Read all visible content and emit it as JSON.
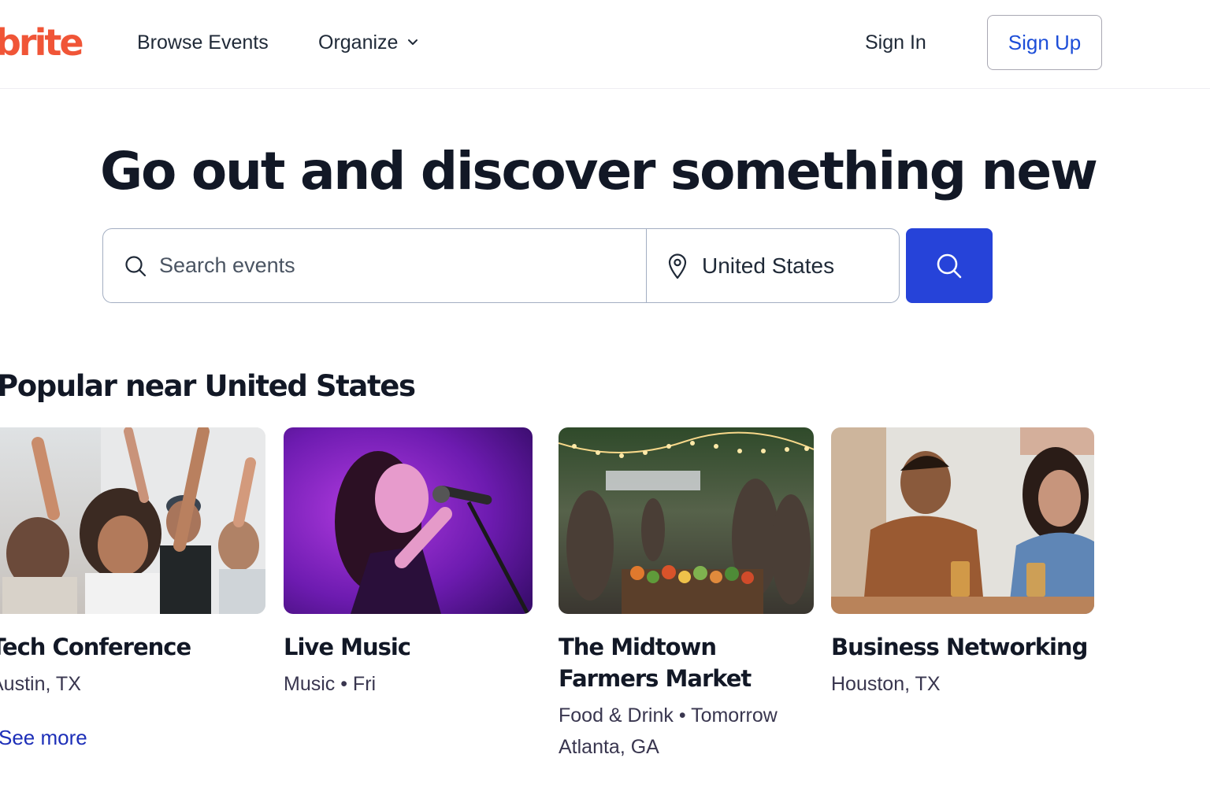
{
  "header": {
    "logo_text": "brite",
    "nav": {
      "browse": "Browse Events",
      "organize": "Organize",
      "sign_in": "Sign In",
      "sign_up": "Sign Up"
    }
  },
  "hero": {
    "title": "Go out and discover something new",
    "search": {
      "placeholder": "Search events",
      "value": "",
      "location": "United States"
    }
  },
  "popular": {
    "title": "Popular near United States",
    "see_more": "See more",
    "cards": [
      {
        "title": "Tech Conference",
        "meta": [
          "Austin, TX"
        ]
      },
      {
        "title": "Live Music",
        "meta": [
          "Music • Fri"
        ]
      },
      {
        "title": "The Midtown Farmers Market",
        "meta": [
          "Food & Drink • Tomorrow",
          "Atlanta, GA"
        ]
      },
      {
        "title": "Business Networking",
        "meta": [
          "Houston, TX"
        ]
      }
    ]
  },
  "colors": {
    "brand": "#f05537",
    "primary": "#2643d9",
    "link": "#1d2fb8",
    "text": "#121826"
  },
  "icons": [
    "chevron-down-icon",
    "search-icon",
    "location-pin-icon"
  ]
}
